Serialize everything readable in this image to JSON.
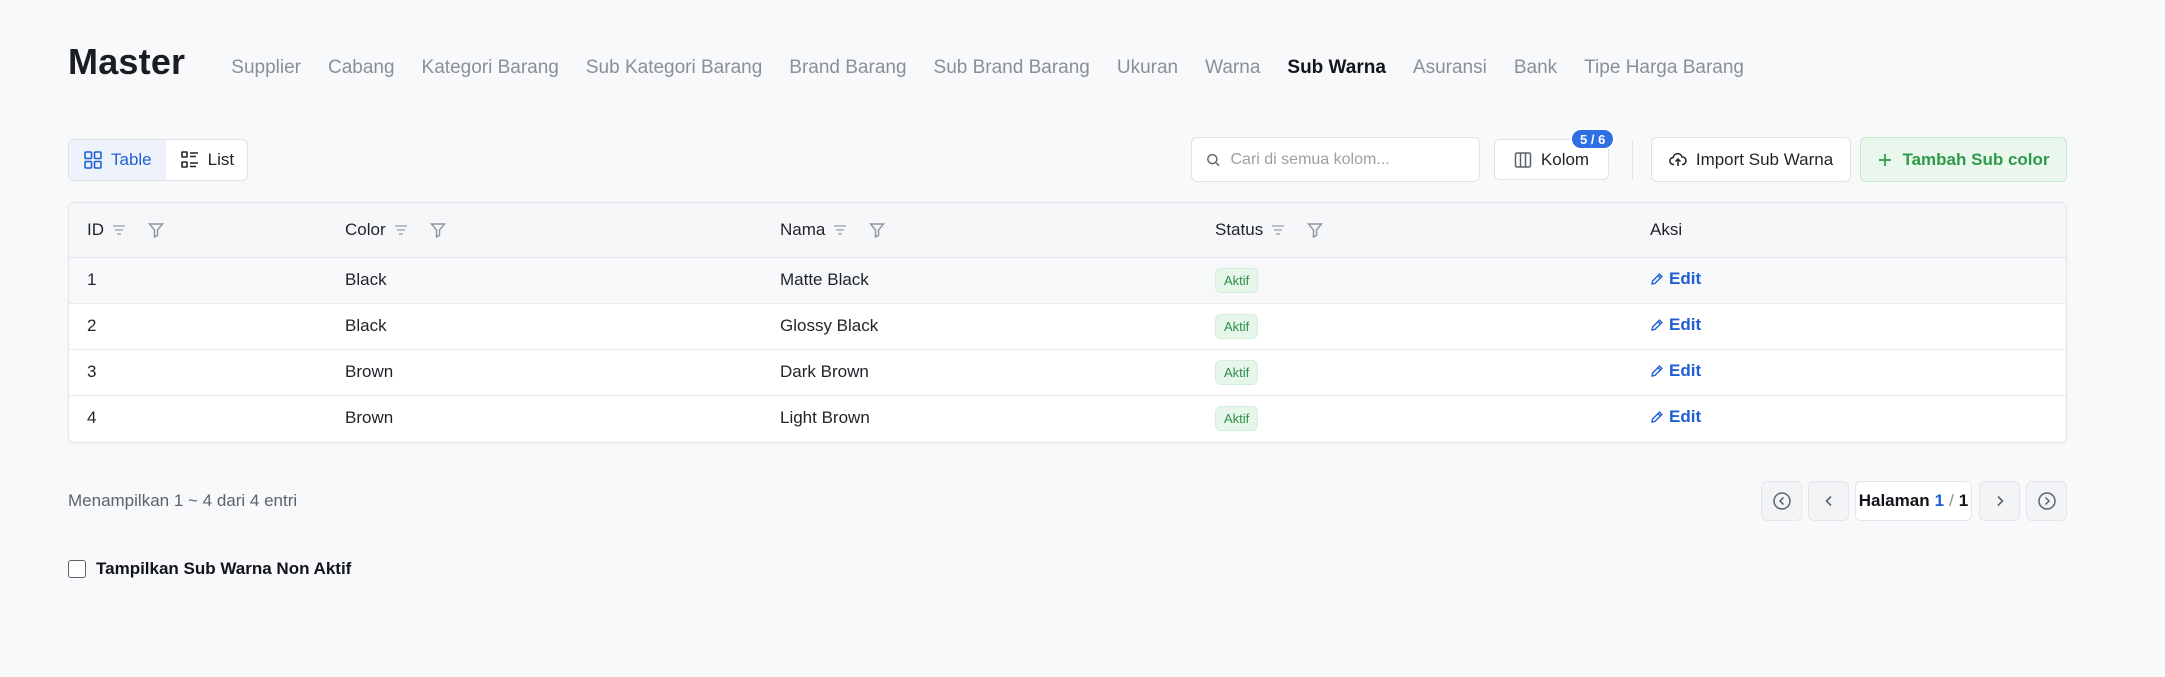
{
  "header": {
    "title": "Master",
    "nav": [
      {
        "label": "Supplier",
        "active": false
      },
      {
        "label": "Cabang",
        "active": false
      },
      {
        "label": "Kategori Barang",
        "active": false
      },
      {
        "label": "Sub Kategori Barang",
        "active": false
      },
      {
        "label": "Brand Barang",
        "active": false
      },
      {
        "label": "Sub Brand Barang",
        "active": false
      },
      {
        "label": "Ukuran",
        "active": false
      },
      {
        "label": "Warna",
        "active": false
      },
      {
        "label": "Sub Warna",
        "active": true
      },
      {
        "label": "Asuransi",
        "active": false
      },
      {
        "label": "Bank",
        "active": false
      },
      {
        "label": "Tipe Harga Barang",
        "active": false
      }
    ]
  },
  "toolbar": {
    "view_table": "Table",
    "view_list": "List",
    "search_placeholder": "Cari di semua kolom...",
    "kolom_label": "Kolom",
    "kolom_badge": "5 / 6",
    "import_label": "Import Sub Warna",
    "add_label": "Tambah Sub color"
  },
  "table": {
    "columns": [
      "ID",
      "Color",
      "Nama",
      "Status",
      "Aksi"
    ],
    "rows": [
      {
        "id": "1",
        "color": "Black",
        "nama": "Matte Black",
        "status": "Aktif",
        "action": "Edit"
      },
      {
        "id": "2",
        "color": "Black",
        "nama": "Glossy Black",
        "status": "Aktif",
        "action": "Edit"
      },
      {
        "id": "3",
        "color": "Brown",
        "nama": "Dark Brown",
        "status": "Aktif",
        "action": "Edit"
      },
      {
        "id": "4",
        "color": "Brown",
        "nama": "Light Brown",
        "status": "Aktif",
        "action": "Edit"
      }
    ]
  },
  "footer": {
    "entries_info": "Menampilkan 1 ~ 4 dari 4 entri",
    "page_prefix": "Halaman",
    "page_current": "1",
    "page_sep": "/",
    "page_total": "1",
    "checkbox_label": "Tampilkan Sub Warna Non Aktif"
  },
  "colors": {
    "accent": "#1f5fd6",
    "success": "#2e9a4a",
    "badge": "#2f6fe4"
  }
}
